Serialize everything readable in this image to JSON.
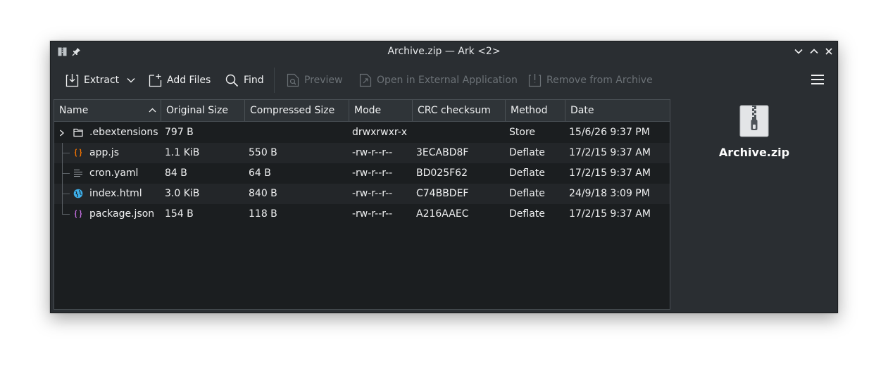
{
  "window": {
    "title": "Archive.zip — Ark <2>"
  },
  "toolbar": {
    "extract": "Extract",
    "add_files": "Add Files",
    "find": "Find",
    "preview": "Preview",
    "open_external": "Open in External Application",
    "remove": "Remove from Archive"
  },
  "table": {
    "columns": [
      "Name",
      "Original Size",
      "Compressed Size",
      "Mode",
      "CRC checksum",
      "Method",
      "Date"
    ],
    "sort_column": "Name",
    "sort_order": "ascending",
    "rows": [
      {
        "name": ".ebextensions",
        "icon": "folder-icon",
        "original": "797 B",
        "compressed": "",
        "mode": "drwxrwxr-x",
        "crc": "",
        "method": "Store",
        "date": "15/6/26 9:37 PM"
      },
      {
        "name": "app.js",
        "icon": "javascript-file-icon",
        "original": "1.1 KiB",
        "compressed": "550 B",
        "mode": "-rw-r--r--",
        "crc": "3ECABD8F",
        "method": "Deflate",
        "date": "17/2/15 9:37 AM"
      },
      {
        "name": "cron.yaml",
        "icon": "text-file-icon",
        "original": "84 B",
        "compressed": "64 B",
        "mode": "-rw-r--r--",
        "crc": "BD025F62",
        "method": "Deflate",
        "date": "17/2/15 9:37 AM"
      },
      {
        "name": "index.html",
        "icon": "html-file-icon",
        "original": "3.0 KiB",
        "compressed": "840 B",
        "mode": "-rw-r--r--",
        "crc": "C74BBDEF",
        "method": "Deflate",
        "date": "24/9/18 3:09 PM"
      },
      {
        "name": "package.json",
        "icon": "json-file-icon",
        "original": "154 B",
        "compressed": "118 B",
        "mode": "-rw-r--r--",
        "crc": "A216AAEC",
        "method": "Deflate",
        "date": "17/2/15 9:37 AM"
      }
    ]
  },
  "info_panel": {
    "archive_name": "Archive.zip",
    "icon": "zip-archive-icon"
  },
  "colors": {
    "window_bg": "#2a2e32",
    "table_bg": "#1b1e20",
    "alt_row_bg": "#232629",
    "text": "#eff0f1",
    "disabled_text": "#6b7176",
    "js_icon": "#f67400",
    "json_icon": "#c56fe2",
    "html_icon": "#3daee9"
  }
}
